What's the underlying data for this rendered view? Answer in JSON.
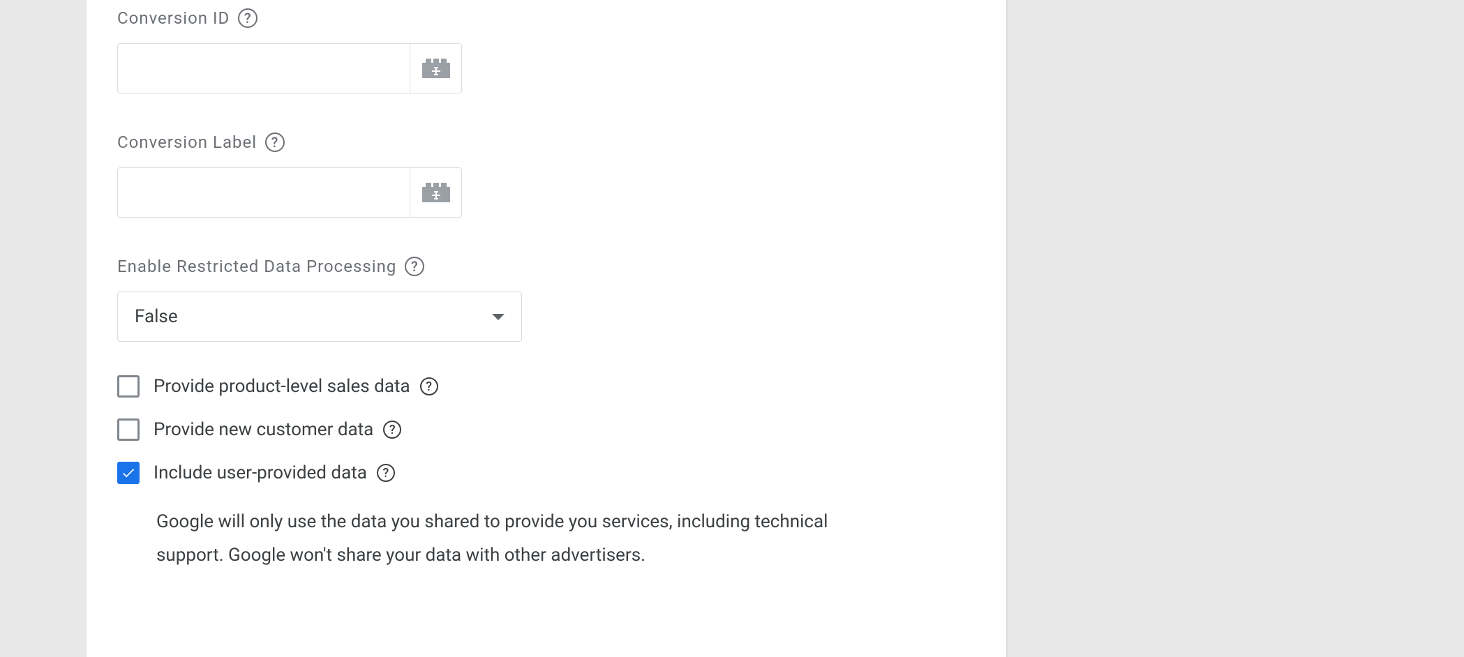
{
  "fields": {
    "conversion_id": {
      "label": "Conversion ID",
      "value": ""
    },
    "conversion_label": {
      "label": "Conversion Label",
      "value": ""
    },
    "restricted_data": {
      "label": "Enable Restricted Data Processing",
      "selected": "False"
    }
  },
  "checkboxes": {
    "product_sales": {
      "label": "Provide product-level sales data",
      "checked": false
    },
    "new_customer": {
      "label": "Provide new customer data",
      "checked": false
    },
    "user_provided": {
      "label": "Include user-provided data",
      "checked": true,
      "description": "Google will only use the data you shared to provide you services, including technical support. Google won't share your data with other advertisers."
    }
  }
}
